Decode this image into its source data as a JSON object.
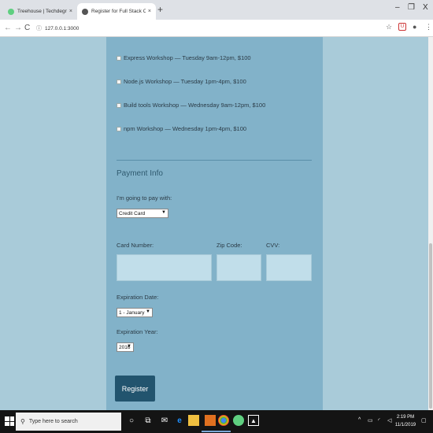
{
  "browser": {
    "tabs": [
      {
        "title": "Treehouse | Techdegree",
        "close": "×"
      },
      {
        "title": "Register for Full Stack Conf",
        "close": "×"
      }
    ],
    "new_tab": "+",
    "window_controls": {
      "minimize": "–",
      "maximize": "❐",
      "close": "X"
    },
    "address": "127.0.0.1:3000",
    "nav": {
      "back": "←",
      "forward": "→",
      "reload": "C"
    },
    "address_info_glyph": "ⓘ"
  },
  "activities": [
    {
      "label": "Express Workshop — Tuesday 9am-12pm, $100"
    },
    {
      "label": "Node.js Workshop — Tuesday 1pm-4pm, $100"
    },
    {
      "label": "Build tools Workshop — Wednesday 9am-12pm, $100"
    },
    {
      "label": "npm Workshop — Wednesday 1pm-4pm, $100"
    }
  ],
  "payment": {
    "legend": "Payment Info",
    "pay_label": "I'm going to pay with:",
    "pay_selected": "Credit Card",
    "card_label": "Card Number:",
    "zip_label": "Zip Code:",
    "cvv_label": "CVV:",
    "exp_date_label": "Expiration Date:",
    "exp_date_selected": "1 - January",
    "exp_year_label": "Expiration Year:",
    "exp_year_selected": "2016",
    "caret": "▼",
    "register": "Register"
  },
  "taskbar": {
    "search_placeholder": "Type here to search",
    "time": "2:19 PM",
    "date": "11/1/2019"
  }
}
